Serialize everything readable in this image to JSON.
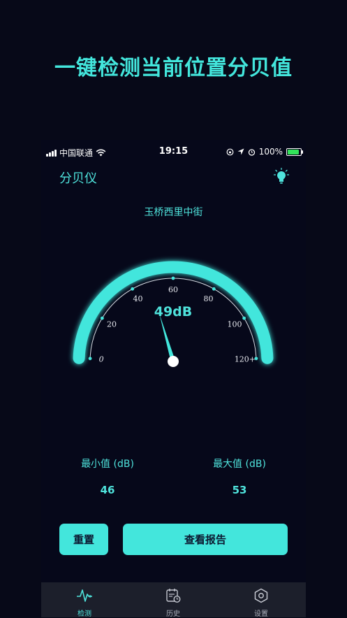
{
  "headline": "一键检测当前位置分贝值",
  "status": {
    "carrier": "中国联通",
    "time": "19:15",
    "battery": "100%"
  },
  "app": {
    "title": "分贝仪",
    "location": "玉桥西里中街"
  },
  "gauge": {
    "reading": "49dB",
    "value": 49,
    "max": 120,
    "ticks": [
      "0",
      "20",
      "40",
      "60",
      "80",
      "100",
      "120+"
    ],
    "accent": "#43e6dc"
  },
  "stats": {
    "min_label": "最小值 (dB)",
    "min_value": "46",
    "max_label": "最大值 (dB)",
    "max_value": "53"
  },
  "buttons": {
    "reset": "重置",
    "report": "查看报告"
  },
  "tabs": [
    {
      "label": "检测",
      "icon": "pulse-icon",
      "active": true
    },
    {
      "label": "历史",
      "icon": "calendar-clock-icon",
      "active": false
    },
    {
      "label": "设置",
      "icon": "hexagon-settings-icon",
      "active": false
    }
  ]
}
